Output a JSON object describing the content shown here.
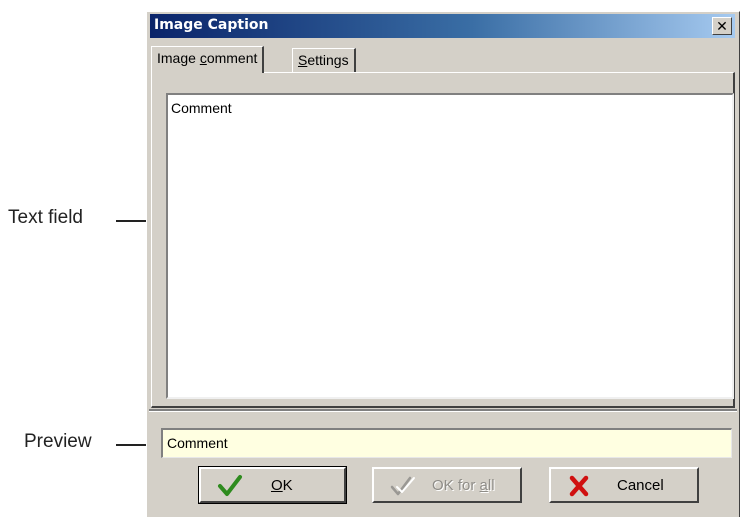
{
  "callouts": {
    "text_field": "Text field",
    "preview": "Preview"
  },
  "window": {
    "title": "Image Caption",
    "close_glyph": "✕"
  },
  "tabs": [
    {
      "label_pre": "Image ",
      "label_mnemonic": "c",
      "label_post": "omment",
      "active": true
    },
    {
      "label_pre": "",
      "label_mnemonic": "S",
      "label_post": "ettings",
      "active": false
    }
  ],
  "comment_field": {
    "value": "Comment"
  },
  "preview_field": {
    "value": "Comment"
  },
  "buttons": {
    "ok": {
      "mnemonic": "O",
      "rest": "K",
      "icon": "checkmark-icon",
      "color": "#2e8b1e"
    },
    "ok_for_all": {
      "pre": "OK for ",
      "mnemonic": "a",
      "post": "ll",
      "icon": "double-check-icon",
      "enabled": false
    },
    "cancel": {
      "label": "Cancel",
      "icon": "cross-icon",
      "color": "#d01010"
    }
  }
}
